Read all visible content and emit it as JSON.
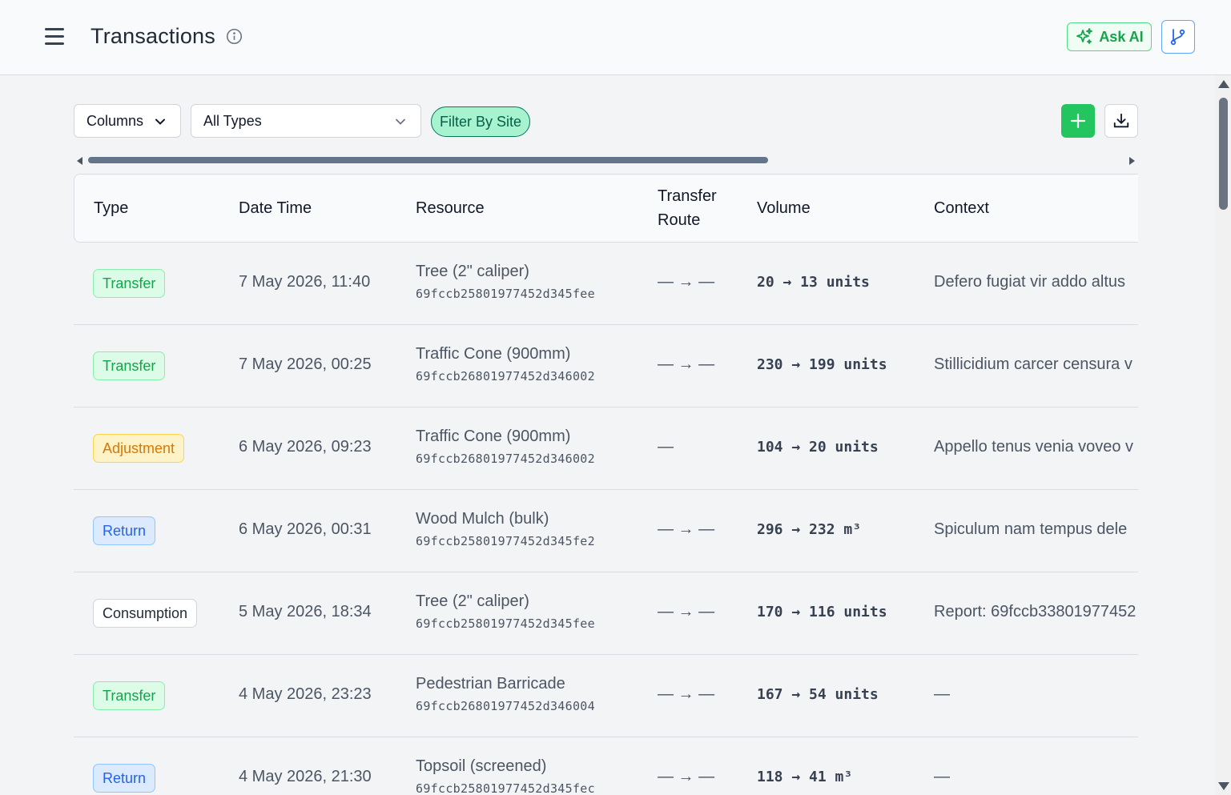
{
  "header": {
    "title": "Transactions",
    "ask_ai_label": "Ask AI"
  },
  "toolbar": {
    "columns_label": "Columns",
    "type_filter_value": "All Types",
    "filter_by_site_label": "Filter By Site"
  },
  "table": {
    "columns": [
      "Type",
      "Date Time",
      "Resource",
      "Transfer",
      "Route",
      "Volume",
      "Context"
    ],
    "rows": [
      {
        "type": "Transfer",
        "datetime": "7 May 2026, 11:40",
        "resource": "Tree (2\" caliper)",
        "resource_id": "69fccb25801977452d345fee",
        "route": "— → —",
        "volume": "20 → 13 units",
        "context": "Defero fugiat vir addo altus"
      },
      {
        "type": "Transfer",
        "datetime": "7 May 2026, 00:25",
        "resource": "Traffic Cone (900mm)",
        "resource_id": "69fccb26801977452d346002",
        "route": "— → —",
        "volume": "230 → 199 units",
        "context": "Stillicidium carcer censura v"
      },
      {
        "type": "Adjustment",
        "datetime": "6 May 2026, 09:23",
        "resource": "Traffic Cone (900mm)",
        "resource_id": "69fccb26801977452d346002",
        "route": "—",
        "volume": "104 → 20 units",
        "context": "Appello tenus venia voveo v"
      },
      {
        "type": "Return",
        "datetime": "6 May 2026, 00:31",
        "resource": "Wood Mulch (bulk)",
        "resource_id": "69fccb25801977452d345fe2",
        "route": "— → —",
        "volume": "296 → 232 m³",
        "context": "Spiculum nam tempus dele"
      },
      {
        "type": "Consumption",
        "datetime": "5 May 2026, 18:34",
        "resource": "Tree (2\" caliper)",
        "resource_id": "69fccb25801977452d345fee",
        "route": "— → —",
        "volume": "170 → 116 units",
        "context": "Report: 69fccb33801977452"
      },
      {
        "type": "Transfer",
        "datetime": "4 May 2026, 23:23",
        "resource": "Pedestrian Barricade",
        "resource_id": "69fccb26801977452d346004",
        "route": "— → —",
        "volume": "167 → 54 units",
        "context": "—"
      },
      {
        "type": "Return",
        "datetime": "4 May 2026, 21:30",
        "resource": "Topsoil (screened)",
        "resource_id": "69fccb25801977452d345fec",
        "route": "— → —",
        "volume": "118 → 41 m³",
        "context": "—"
      }
    ]
  },
  "colors": {
    "transfer": "#16a34a",
    "adjustment": "#d97706",
    "return": "#2563eb",
    "accent_green": "#22c55e"
  },
  "icons": [
    "menu-icon",
    "info-icon",
    "sparkle-icon",
    "git-branch-icon",
    "chevron-down-icon",
    "plus-icon",
    "download-icon"
  ]
}
